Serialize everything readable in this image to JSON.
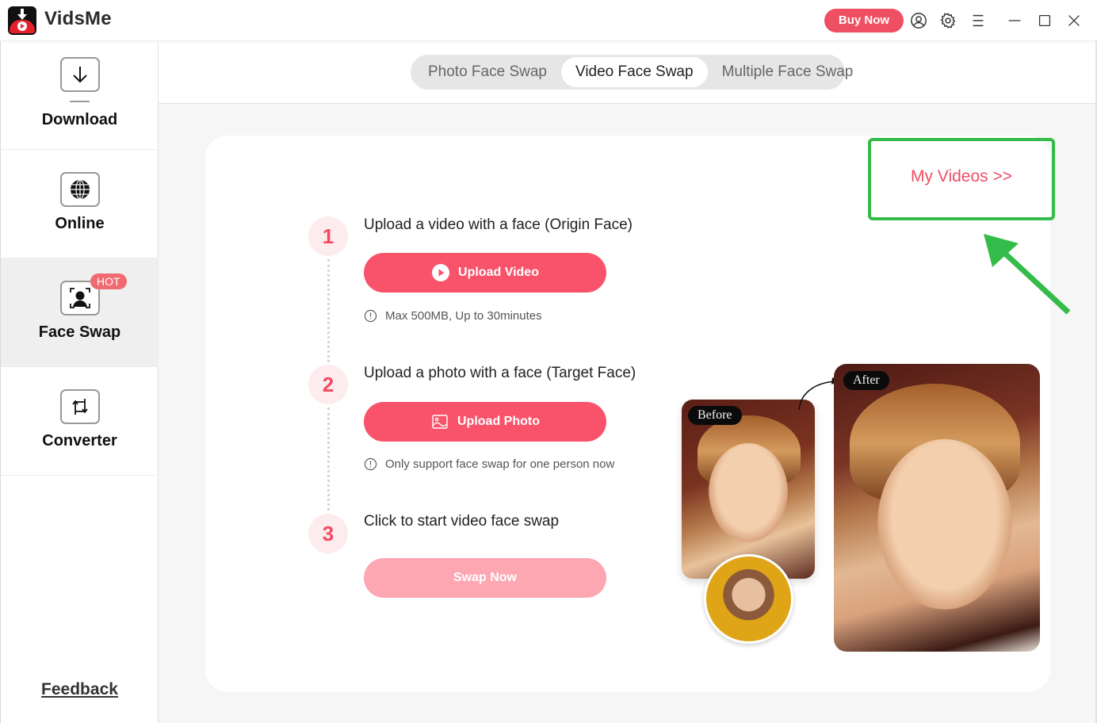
{
  "app": {
    "title": "VidsMe",
    "buy_now_label": "Buy Now",
    "icons": [
      "account-icon",
      "settings-icon",
      "menu-icon",
      "minimize-icon",
      "maximize-icon",
      "close-icon"
    ]
  },
  "sidebar": {
    "items": [
      {
        "label": "Download",
        "icon": "download-icon",
        "active": false
      },
      {
        "label": "Online",
        "icon": "globe-icon",
        "active": false
      },
      {
        "label": "Face Swap",
        "icon": "face-scan-icon",
        "active": true,
        "badge": "HOT"
      },
      {
        "label": "Converter",
        "icon": "convert-icon",
        "active": false
      }
    ],
    "feedback_label": "Feedback"
  },
  "tabs": [
    {
      "label": "Photo Face Swap",
      "active": false
    },
    {
      "label": "Video Face Swap",
      "active": true
    },
    {
      "label": "Multiple Face Swap",
      "active": false
    }
  ],
  "main": {
    "my_videos_label": "My Videos >>",
    "steps": [
      {
        "number": "1",
        "title": "Upload a video with a face  (Origin Face)",
        "button_label": "Upload Video",
        "button_icon": "play-circle-icon",
        "hint": "Max 500MB, Up to 30minutes"
      },
      {
        "number": "2",
        "title": "Upload a photo with a face  (Target Face)",
        "button_label": "Upload Photo",
        "button_icon": "image-icon",
        "hint": "Only support face swap for one person now"
      },
      {
        "number": "3",
        "title": "Click to start video face swap",
        "button_label": "Swap Now",
        "button_disabled": true
      }
    ],
    "preview": {
      "before_label": "Before",
      "after_label": "After"
    }
  },
  "colors": {
    "accent": "#f8536a",
    "accent_disabled": "#fda7b2",
    "highlight_green": "#34bc4a",
    "hot_badge": "#f06a72"
  }
}
